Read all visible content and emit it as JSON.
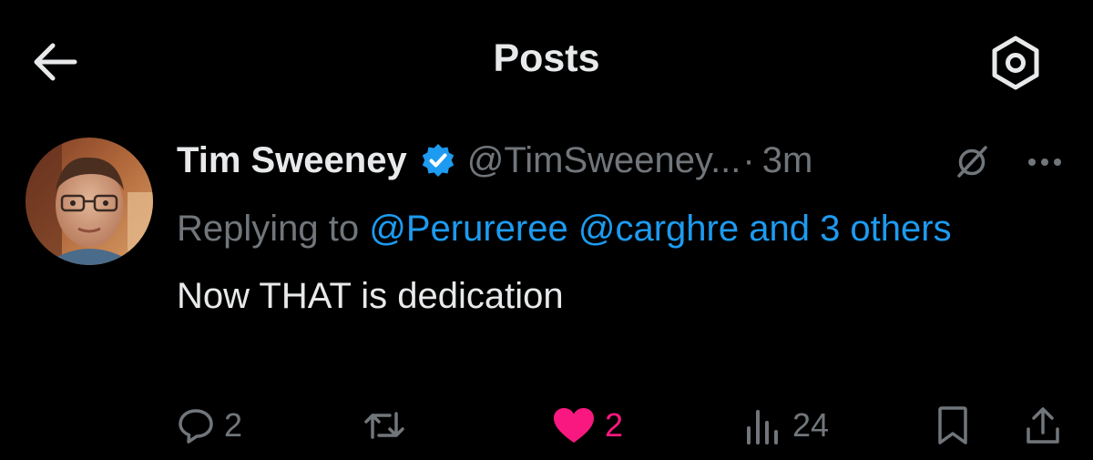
{
  "header": {
    "title": "Posts",
    "back_icon": "arrow-left-icon",
    "settings_icon": "gear-icon"
  },
  "post": {
    "author_name": "Tim Sweeney",
    "verified_icon": "verified-badge-icon",
    "handle": "@TimSweeney...",
    "separator": "·",
    "timestamp": "3m",
    "reply_prefix": "Replying to",
    "mention_1": "@Perureree",
    "mention_2": "@carghre",
    "mention_rest": "and 3 others",
    "text": "Now THAT is dedication",
    "actions": {
      "reply_count": "2",
      "repost_count": "",
      "like_count": "2",
      "views_count": "24"
    }
  },
  "colors": {
    "background": "#000000",
    "text_primary": "#e7e9ea",
    "text_secondary": "#71767b",
    "accent_blue": "#1d9bf0",
    "like_pink": "#f91880"
  }
}
